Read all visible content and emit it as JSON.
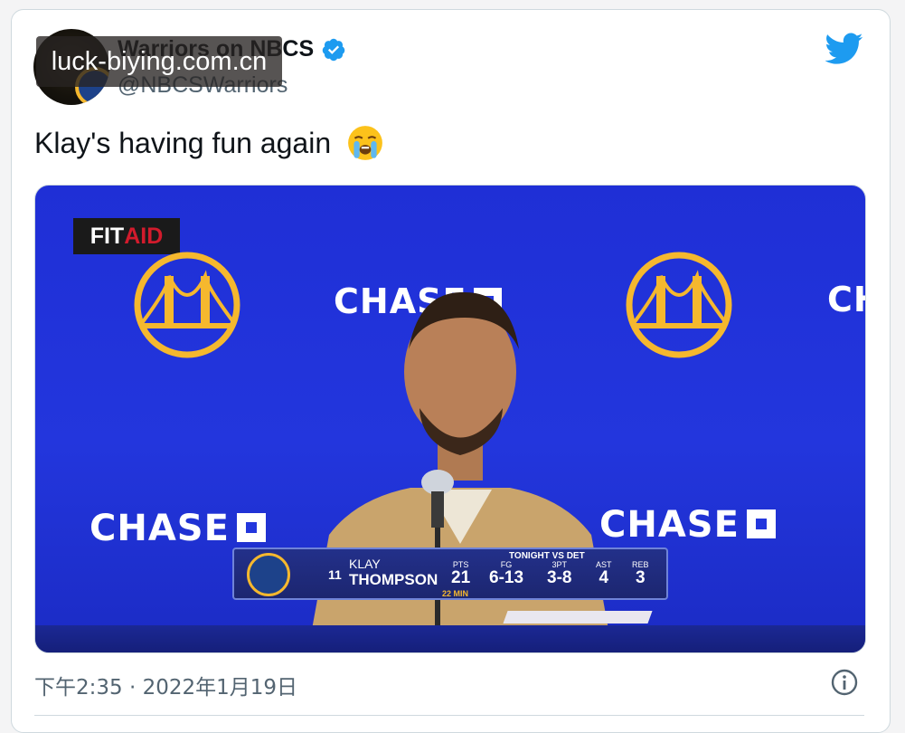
{
  "tweet": {
    "display_name": "Warriors on NBCS",
    "handle": "@NBCSWarriors",
    "text": "Klay's having fun again",
    "emoji": "loudly-crying-face",
    "timestamp": "下午2:35 · 2022年1月19日",
    "verified": true
  },
  "watermark": {
    "text": "luck-biying.com.cn"
  },
  "icons": {
    "verified": "verified-badge-icon",
    "twitter": "twitter-bird-icon",
    "info": "info-icon"
  },
  "media": {
    "bug": {
      "part1": "FIT",
      "part2": "AID"
    },
    "sponsor": "CHASE",
    "partial_sponsor": "CH",
    "team_logo": "GOLDEN STATE WARRIORS",
    "lower_third": {
      "number": "11",
      "first_name": "KLAY",
      "last_name": "THOMPSON",
      "header": "TONIGHT VS DET",
      "minutes": "22 MIN",
      "stats": [
        {
          "label": "PTS",
          "value": "21"
        },
        {
          "label": "FG",
          "value": "6-13"
        },
        {
          "label": "3PT",
          "value": "3-8"
        },
        {
          "label": "AST",
          "value": "4"
        },
        {
          "label": "REB",
          "value": "3"
        }
      ]
    }
  },
  "colors": {
    "twitter_blue": "#1d9bf0",
    "backdrop_blue": "#2336dd",
    "warriors_gold": "#f5b82e",
    "text_primary": "#0f1419",
    "text_secondary": "#536471"
  }
}
